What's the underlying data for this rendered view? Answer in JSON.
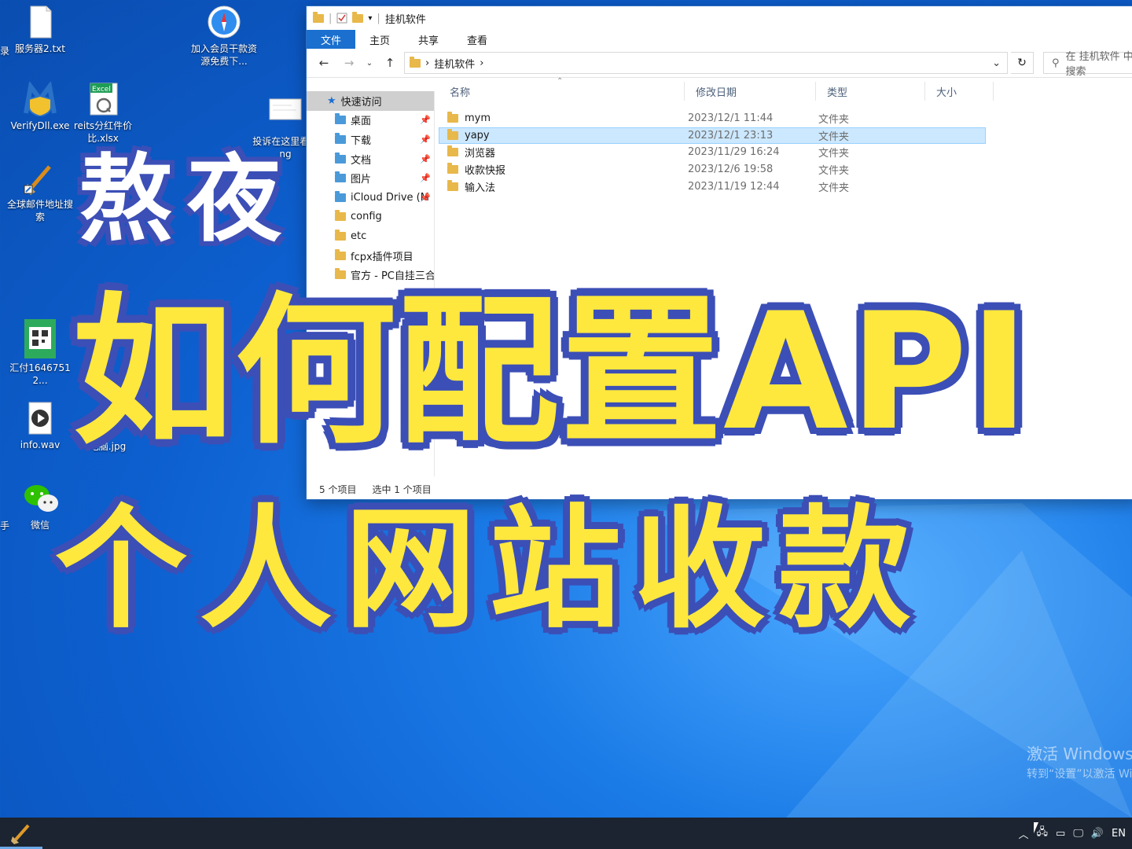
{
  "desktop": {
    "icons": [
      {
        "label": "服务器2.txt"
      },
      {
        "label": "加入会员干款资源免费下..."
      },
      {
        "label": "VerifyDll.exe"
      },
      {
        "label": "reits分红件价比.xlsx"
      },
      {
        "label": "投诉在这里看.png"
      },
      {
        "label": "全球邮件地址搜索"
      },
      {
        "label": "汇付16467512..."
      },
      {
        "label": "info.wav"
      },
      {
        "label": "电脑.jpg"
      },
      {
        "label": "微信"
      }
    ],
    "excel_badge": "Excel",
    "edge_chars": [
      "录",
      "手"
    ]
  },
  "explorer": {
    "title": "挂机软件",
    "ribbon_tabs": [
      "文件",
      "主页",
      "共享",
      "查看"
    ],
    "breadcrumb": "挂机软件",
    "search_placeholder": "在 挂机软件 中搜索",
    "nav_items": [
      {
        "label": "快速访问"
      },
      {
        "label": "桌面"
      },
      {
        "label": "下载"
      },
      {
        "label": "文档"
      },
      {
        "label": "图片"
      },
      {
        "label": "iCloud Drive (M"
      },
      {
        "label": "config"
      },
      {
        "label": "etc"
      },
      {
        "label": "fcpx插件项目"
      },
      {
        "label": "官方 - PC自挂三合一"
      }
    ],
    "columns": [
      "名称",
      "修改日期",
      "类型",
      "大小"
    ],
    "files": [
      {
        "name": "mym",
        "date": "2023/12/1 11:44",
        "type": "文件夹"
      },
      {
        "name": "yapy",
        "date": "2023/12/1 23:13",
        "type": "文件夹"
      },
      {
        "name": "浏览器",
        "date": "2023/11/29 16:24",
        "type": "文件夹"
      },
      {
        "name": "收款快报",
        "date": "2023/12/6 19:58",
        "type": "文件夹"
      },
      {
        "name": "输入法",
        "date": "2023/11/19 12:44",
        "type": "文件夹"
      }
    ],
    "status_count": "5 个项目",
    "status_selected": "选中 1 个项目"
  },
  "overlay": {
    "line1": "熬夜",
    "line2": "如何配置API",
    "line3": "个人网站收款"
  },
  "watermark": {
    "line1": "激活 Windows",
    "line2": "转到“设置”以激活 Windows。"
  },
  "taskbar": {
    "lang": "EN"
  },
  "colors": {
    "accent": "#1a6fcf",
    "overlay_yellow": "#ffe83d",
    "overlay_outline": "#3c4fb6",
    "selected_row": "#cce8ff"
  }
}
